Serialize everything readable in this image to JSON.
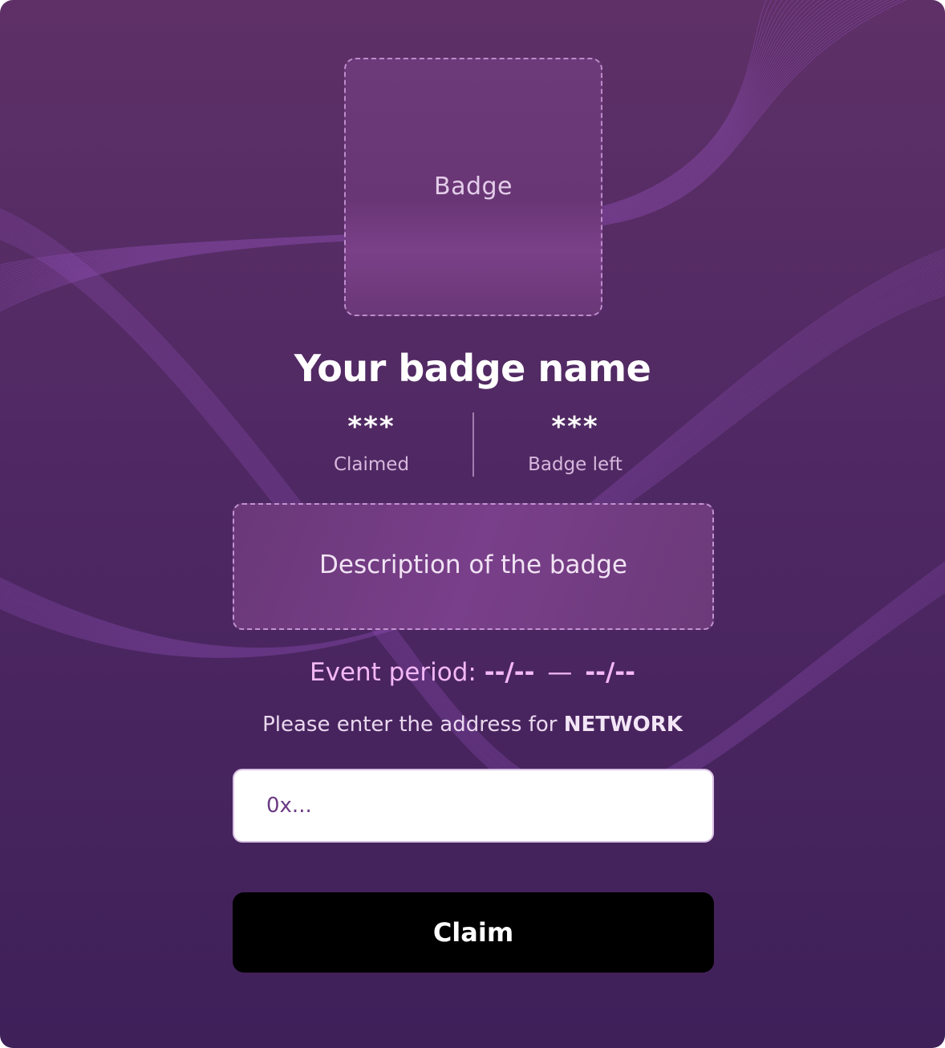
{
  "badge": {
    "placeholder_label": "Badge",
    "name": "Your badge name",
    "description": "Description of the badge"
  },
  "stats": {
    "claimed": {
      "value": "***",
      "label": "Claimed"
    },
    "left": {
      "value": "***",
      "label": "Badge left"
    }
  },
  "event": {
    "label": "Event period:",
    "start": "--/--",
    "separator": "—",
    "end": "--/--"
  },
  "network_prompt": {
    "text": "Please enter the address for",
    "network": "NETWORK"
  },
  "address_input": {
    "value": "",
    "placeholder": "0x..."
  },
  "claim_button": {
    "label": "Claim"
  },
  "colors": {
    "background_top": "#5e3067",
    "background_bottom": "#3f2059",
    "accent_pink": "#f4b8f6",
    "button_bg": "#000000",
    "wave_line": "#a35bd0"
  }
}
